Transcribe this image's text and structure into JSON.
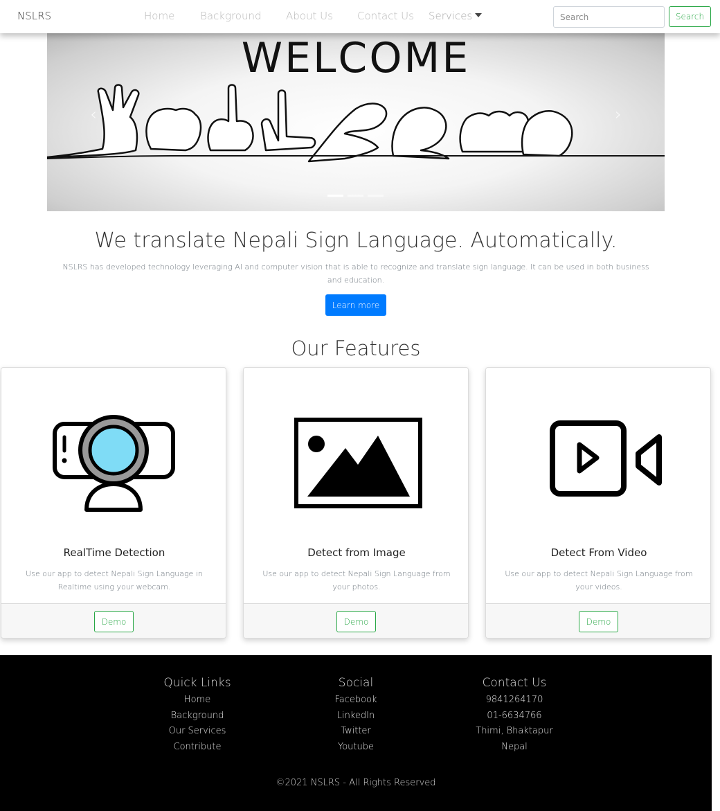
{
  "navbar": {
    "brand": "NSLRS",
    "links": [
      "Home",
      "Background",
      "About Us",
      "Contact Us"
    ],
    "services_label": "Services",
    "search_placeholder": "Search",
    "search_button": "Search"
  },
  "carousel": {
    "slide_text": "WELCOME",
    "slide_count": 3,
    "active_slide": 1
  },
  "hero": {
    "title": "We translate Nepali Sign Language. Automatically.",
    "text": "NSLRS has developed technology leveraging AI and computer vision that is able to recognize and translate sign language. It can be used in both business and education.",
    "button": "Learn more"
  },
  "features": {
    "title": "Our Features",
    "cards": [
      {
        "title": "RealTime Detection",
        "text": "Use our app to detect Nepali Sign Language in Realtime using your webcam.",
        "button": "Demo",
        "icon": "webcam-icon"
      },
      {
        "title": "Detect from Image",
        "text": "Use our app to detect Nepali Sign Language from your photos.",
        "button": "Demo",
        "icon": "image-icon"
      },
      {
        "title": "Detect From Video",
        "text": "Use our app to detect Nepali Sign Language from your videos.",
        "button": "Demo",
        "icon": "video-icon"
      }
    ]
  },
  "footer": {
    "quick_links": {
      "title": "Quick Links",
      "items": [
        "Home",
        "Background",
        "Our Services",
        "Contribute"
      ]
    },
    "social": {
      "title": "Social",
      "items": [
        "Facebook",
        "LinkedIn",
        "Twitter",
        "Youtube"
      ]
    },
    "contact": {
      "title": "Contact Us",
      "items": [
        "9841264170",
        "01-6634766",
        "Thimi, Bhaktapur",
        "Nepal"
      ]
    },
    "copyright": "©2021 NSLRS - All Rights Reserved"
  },
  "colors": {
    "primary": "#007bff",
    "success": "#28a745",
    "footer_bg": "#000000",
    "webcam_lens": "#7fdcf6"
  }
}
